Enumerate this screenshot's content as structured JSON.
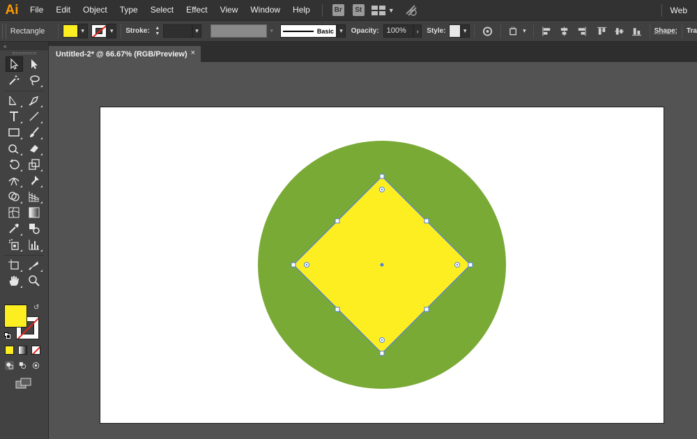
{
  "app": {
    "logo": "Ai",
    "logo_color": "#ff9a00"
  },
  "menu": [
    "File",
    "Edit",
    "Object",
    "Type",
    "Select",
    "Effect",
    "View",
    "Window",
    "Help"
  ],
  "menubar_icons": {
    "bridge": "Br",
    "stock": "St",
    "arrange": "arrange-documents-icon",
    "gpu": "gpu-performance-icon"
  },
  "workspace": {
    "label": "Web"
  },
  "control": {
    "tool_name": "Rectangle",
    "fill_color": "#fcee21",
    "stroke_label": "Stroke:",
    "stroke_value": "",
    "brush_label": "Basic",
    "opacity_label": "Opacity:",
    "opacity_value": "100%",
    "style_label": "Style:",
    "shape_label": "Shape:",
    "transform_label": "Tra"
  },
  "document": {
    "tab_title": "Untitled-2* @ 66.67% (RGB/Preview)",
    "close": "×",
    "zoom": "66.67%"
  },
  "tools": [
    [
      "selection-tool",
      "direct-selection-tool"
    ],
    [
      "magic-wand-tool",
      "lasso-tool"
    ],
    [
      "pen-tool",
      "curvature-tool"
    ],
    [
      "type-tool",
      "line-segment-tool"
    ],
    [
      "rectangle-tool",
      "paintbrush-tool"
    ],
    [
      "shaper-tool",
      "eraser-tool"
    ],
    [
      "rotate-tool",
      "scale-tool"
    ],
    [
      "width-tool",
      "puppet-warp-tool"
    ],
    [
      "shape-builder-tool",
      "perspective-grid-tool"
    ],
    [
      "mesh-tool",
      "gradient-tool"
    ],
    [
      "eyedropper-tool",
      "blend-tool"
    ],
    [
      "symbol-sprayer-tool",
      "column-graph-tool"
    ],
    [
      "artboard-tool",
      "slice-tool"
    ],
    [
      "hand-tool",
      "zoom-tool"
    ]
  ],
  "colors": {
    "fill": "#fcee21",
    "stroke": "none",
    "circle": "#7aaa36",
    "diamond": "#fcee21",
    "selection": "#4f7fe0"
  }
}
